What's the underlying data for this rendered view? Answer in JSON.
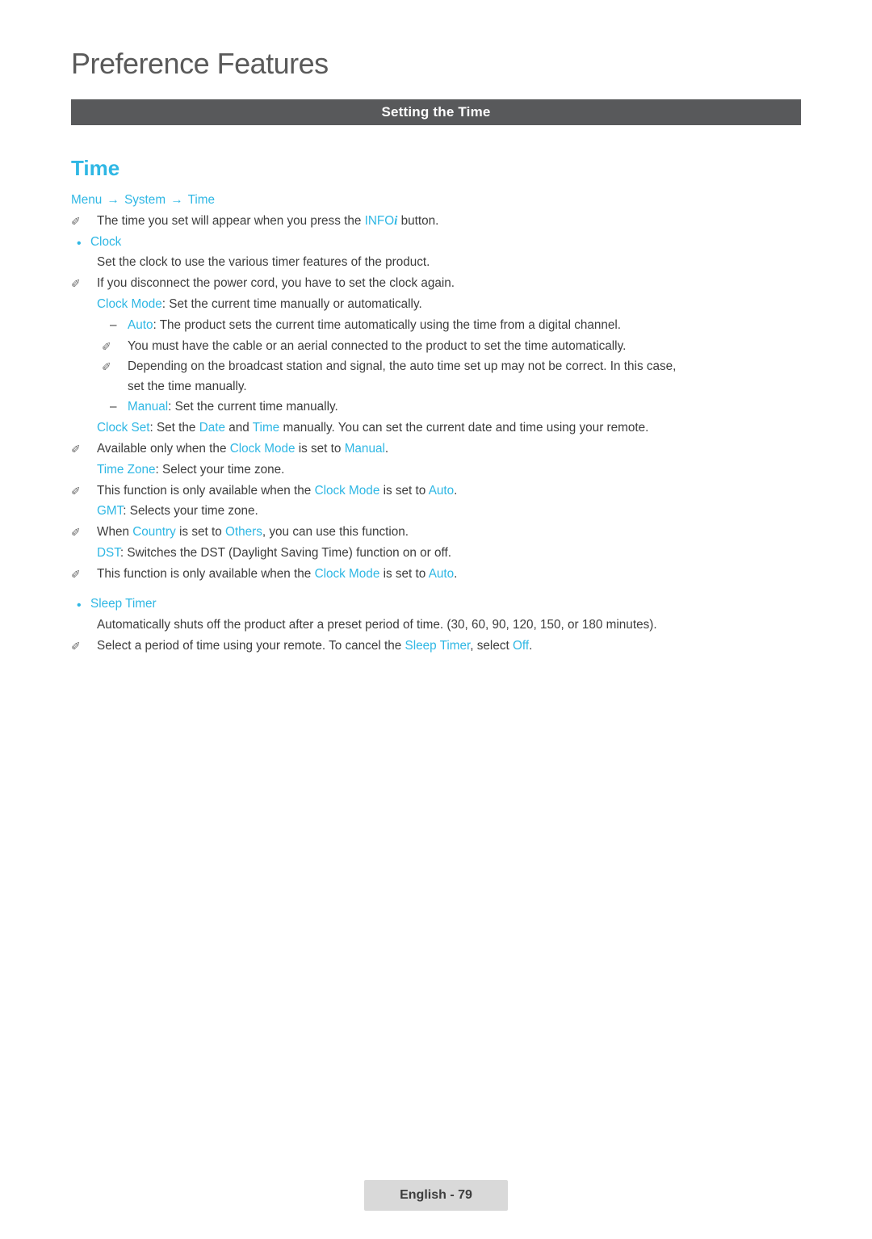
{
  "chapter": {
    "title": "Preference Features"
  },
  "section_bar": {
    "title": "Setting the Time"
  },
  "heading": {
    "title": "Time"
  },
  "breadcrumb": {
    "item1": "Menu",
    "arrow1": "→",
    "item2": "System",
    "arrow2": "→",
    "item3": "Time"
  },
  "notes": {
    "note_icon": "✐",
    "info_note_pre": "The time you set will appear when you press the ",
    "info_label": "INFO",
    "info_label_i": "i",
    "info_note_post": " button."
  },
  "clock": {
    "bullet_label": "Clock",
    "line1": "Set the clock to use the various timer features of the product.",
    "note1": "If you disconnect the power cord, you have to set the clock again.",
    "clock_mode_label": "Clock Mode",
    "clock_mode_text": ": Set the current time manually or automatically.",
    "auto_label": "Auto",
    "auto_text": ": The product sets the current time automatically using the time from a digital channel.",
    "auto_note1": "You must have the cable or an aerial connected to the product to set the time automatically.",
    "auto_note2_l1": "Depending on the broadcast station and signal, the auto time set up may not be correct. In this case,",
    "auto_note2_l2": "set the time manually.",
    "manual_label": "Manual",
    "manual_text": ": Set the current time manually.",
    "clock_set_label": "Clock Set",
    "clock_set_t1": ": Set the ",
    "clock_set_date": "Date",
    "clock_set_t2": " and ",
    "clock_set_time": "Time",
    "clock_set_t3": " manually. You can set the current date and time using your remote.",
    "clock_set_note_pre": "Available only when the ",
    "clock_set_note_mode": "Clock Mode",
    "clock_set_note_mid": " is set to ",
    "clock_set_note_manual": "Manual",
    "clock_set_note_post": ".",
    "time_zone_label": "Time Zone",
    "time_zone_text": ": Select your time zone.",
    "time_zone_note_pre": "This function is only available when the ",
    "time_zone_note_mode": "Clock Mode",
    "time_zone_note_mid": " is set to ",
    "time_zone_note_auto": "Auto",
    "time_zone_note_post": ".",
    "gmt_label": "GMT",
    "gmt_text": ": Selects your time zone.",
    "gmt_note_pre": "When ",
    "gmt_note_country": "Country",
    "gmt_note_mid": " is set to ",
    "gmt_note_others": "Others",
    "gmt_note_post": ", you can use this function.",
    "dst_label": "DST",
    "dst_text": ": Switches the DST (Daylight Saving Time) function on or off.",
    "dst_note_pre": "This function is only available when the ",
    "dst_note_mode": "Clock Mode",
    "dst_note_mid": " is set to ",
    "dst_note_auto": "Auto",
    "dst_note_post": "."
  },
  "sleep_timer": {
    "bullet_label": "Sleep Timer",
    "line1": "Automatically shuts off the product after a preset period of time. (30, 60, 90, 120, 150, or 180 minutes).",
    "note_pre": "Select a period of time using your remote. To cancel the ",
    "note_label": "Sleep Timer",
    "note_mid": ", select ",
    "note_off": "Off",
    "note_post": "."
  },
  "footer": {
    "label": "English - 79"
  },
  "colors": {
    "accent": "#2fb7e4",
    "section_bar_bg": "#58595b",
    "footer_bg": "#d9d9d9",
    "body_text": "#3d3d3d",
    "chapter_text": "#5a5a5a"
  }
}
